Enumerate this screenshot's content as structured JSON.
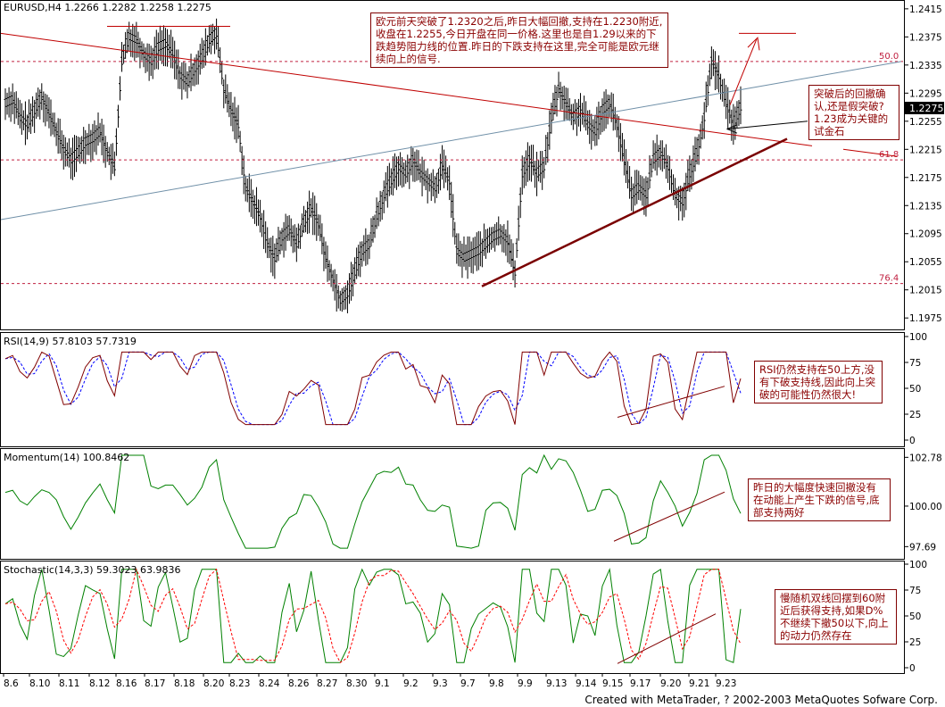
{
  "chart_data": {
    "type": "candlestick-panel",
    "symbol_header": "EURUSD,H4  1.2266 1.2282 1.2258 1.2275",
    "current_price": "1.2275",
    "price_axis": {
      "ticks": [
        "1.2415",
        "1.2375",
        "1.2335",
        "1.2295",
        "1.2255",
        "1.2215",
        "1.2175",
        "1.2135",
        "1.2095",
        "1.2055",
        "1.2015",
        "1.1975"
      ],
      "range": [
        1.196,
        1.2425
      ]
    },
    "fib_levels": [
      {
        "label": "50.0",
        "price": 1.234
      },
      {
        "label": "61.8",
        "price": 1.22
      },
      {
        "label": "76.4",
        "price": 1.2024
      }
    ],
    "price_series": [
      1.228,
      1.2285,
      1.226,
      1.225,
      1.227,
      1.229,
      1.2265,
      1.224,
      1.2215,
      1.22,
      1.221,
      1.2225,
      1.223,
      1.224,
      1.221,
      1.219,
      1.234,
      1.2375,
      1.237,
      1.235,
      1.234,
      1.236,
      1.2365,
      1.235,
      1.232,
      1.231,
      1.233,
      1.2345,
      1.237,
      1.238,
      1.23,
      1.227,
      1.225,
      1.216,
      1.214,
      1.212,
      1.208,
      1.206,
      1.209,
      1.21,
      1.208,
      1.211,
      1.213,
      1.211,
      1.206,
      1.203,
      1.2,
      1.201,
      1.204,
      1.207,
      1.208,
      1.212,
      1.215,
      1.217,
      1.219,
      1.218,
      1.22,
      1.218,
      1.217,
      1.216,
      1.219,
      1.217,
      1.207,
      1.206,
      1.2065,
      1.207,
      1.208,
      1.209,
      1.2095,
      1.2085,
      1.204,
      1.218,
      1.22,
      1.218,
      1.219,
      1.226,
      1.23,
      1.228,
      1.226,
      1.227,
      1.225,
      1.224,
      1.227,
      1.228,
      1.225,
      1.22,
      1.215,
      1.216,
      1.215,
      1.22,
      1.221,
      1.219,
      1.215,
      1.214,
      1.218,
      1.221,
      1.226,
      1.234,
      1.232,
      1.228,
      1.225,
      1.2275
    ],
    "trend_lines": [
      "upper downtrend (red)",
      "lower uptrend (dark red)",
      "long ascending (blue-gray)"
    ],
    "subcharts": [
      {
        "name": "rsi",
        "header": "RSI(14,9) 57.8103 57.7319",
        "ticks": [
          "100",
          "75",
          "50",
          "25",
          "0"
        ],
        "range": [
          0,
          100
        ]
      },
      {
        "name": "momentum",
        "header": "Momentum(14) 100.8462",
        "ticks": [
          "102.78",
          "100.00",
          "97.69"
        ],
        "range": [
          97.3,
          103.0
        ]
      },
      {
        "name": "stochastic",
        "header": "Stochastic(14,3,3) 59.3023 63.9836",
        "ticks": [
          "100",
          "75",
          "50",
          "25",
          "0"
        ],
        "range": [
          0,
          100
        ]
      }
    ],
    "x_axis_labels": [
      "8.6",
      "8.10",
      "8.11",
      "8.12",
      "8.16",
      "8.17",
      "8.18",
      "8.20",
      "8.23",
      "8.24",
      "8.26",
      "8.27",
      "8.30",
      "9.1",
      "9.2",
      "9.3",
      "9.7",
      "9.8",
      "9.9",
      "9.13",
      "9.14",
      "9.15",
      "9.17",
      "9.20",
      "9.21",
      "9.23"
    ]
  },
  "annotations": {
    "main": "欧元前天突破了1.2320之后,昨日大幅回撤,支持在1.2230附近,收盘在1.2255,今日开盘在同一价格.这里也是自1.29以来的下跌趋势阻力线的位置.昨日的下跌支持在这里,完全可能是欧元继续向上的信号.",
    "right": "突破后的回撤确认,还是假突破? 1.23成为关键的试金石",
    "rsi": "RSI仍然支持在50上方,没有下破支持线,因此向上突破的可能性仍然很大!",
    "momentum": "昨日的大幅度快速回撤没有在动能上产生下跌的信号,底部支持两好",
    "stochastic": "慢随机双线回摆到60附近后获得支持,如果D%不继续下撤50以下,向上的动力仍然存在"
  },
  "footer": "Created with MetaTrader, ? 2002-2003 MetaQuotes Sofware Corp.",
  "colors": {
    "candle": "#000000",
    "fib": "#c02040",
    "downtrend": "#c00000",
    "uptrend": "#7a0000",
    "blueline": "#7090a8",
    "rsi_main": "#800000",
    "rsi_signal": "#0000ff",
    "momentum": "#008000",
    "stoch_k": "#008000",
    "stoch_d": "#ff0000"
  }
}
